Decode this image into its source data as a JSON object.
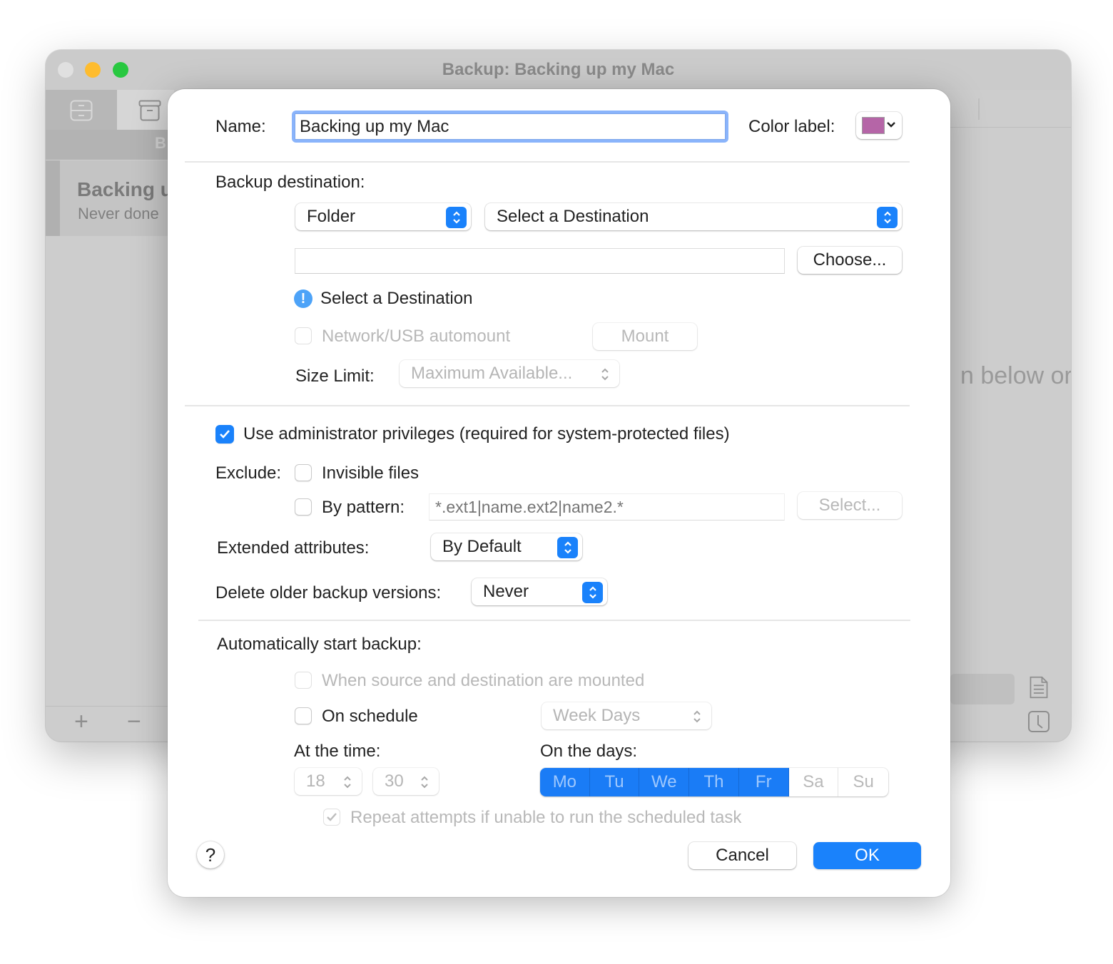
{
  "window": {
    "title": "Backup: Backing up my Mac",
    "sidebar_header_partial": "B",
    "sidebar_item": {
      "title": "Backing up my Mac",
      "subtitle": "Never done"
    },
    "footer": {
      "add_label": "+",
      "remove_label": "−"
    },
    "background_hint_partial": "n below or",
    "toolbar_icons": [
      "tray-icon",
      "archive-box-icon"
    ],
    "right_icons": [
      "document-icon",
      "clock-icon"
    ]
  },
  "dialog": {
    "name_label": "Name:",
    "name_value": "Backing up my Mac",
    "color_label": "Color label:",
    "color_value": "#b565a7",
    "destination": {
      "heading": "Backup destination:",
      "type_popup": "Folder",
      "destination_popup": "Select a Destination",
      "path_value": "",
      "choose_button": "Choose...",
      "warning_text": "Select a Destination",
      "automount_label": "Network/USB automount",
      "automount_checked": false,
      "mount_button": "Mount",
      "size_limit_label": "Size Limit:",
      "size_limit_value": "Maximum Available..."
    },
    "options": {
      "admin_label": "Use administrator privileges (required for system-protected files)",
      "admin_checked": true,
      "exclude_label": "Exclude:",
      "invisible_label": "Invisible files",
      "invisible_checked": false,
      "pattern_label": "By pattern:",
      "pattern_checked": false,
      "pattern_placeholder": "*.ext1|name.ext2|name2.*",
      "pattern_select_button": "Select...",
      "ext_attr_label": "Extended attributes:",
      "ext_attr_value": "By Default",
      "delete_label": "Delete older backup versions:",
      "delete_value": "Never"
    },
    "schedule": {
      "heading": "Automatically start backup:",
      "when_mounted_label": "When source and destination are mounted",
      "when_mounted_checked": false,
      "on_schedule_label": "On schedule",
      "on_schedule_checked": false,
      "frequency_value": "Week Days",
      "time_label": "At the time:",
      "hour": "18",
      "minute": "30",
      "days_label": "On the days:",
      "days": [
        {
          "label": "Mo",
          "selected": true
        },
        {
          "label": "Tu",
          "selected": true
        },
        {
          "label": "We",
          "selected": true
        },
        {
          "label": "Th",
          "selected": true
        },
        {
          "label": "Fr",
          "selected": true
        },
        {
          "label": "Sa",
          "selected": false
        },
        {
          "label": "Su",
          "selected": false
        }
      ],
      "repeat_label": "Repeat attempts if unable to run the scheduled task",
      "repeat_checked": true
    },
    "help_label": "?",
    "cancel_button": "Cancel",
    "ok_button": "OK"
  },
  "colors": {
    "accent": "#1a82fb",
    "close": "#e0e0e0",
    "minimize": "#febc2e",
    "zoom": "#28c840"
  }
}
